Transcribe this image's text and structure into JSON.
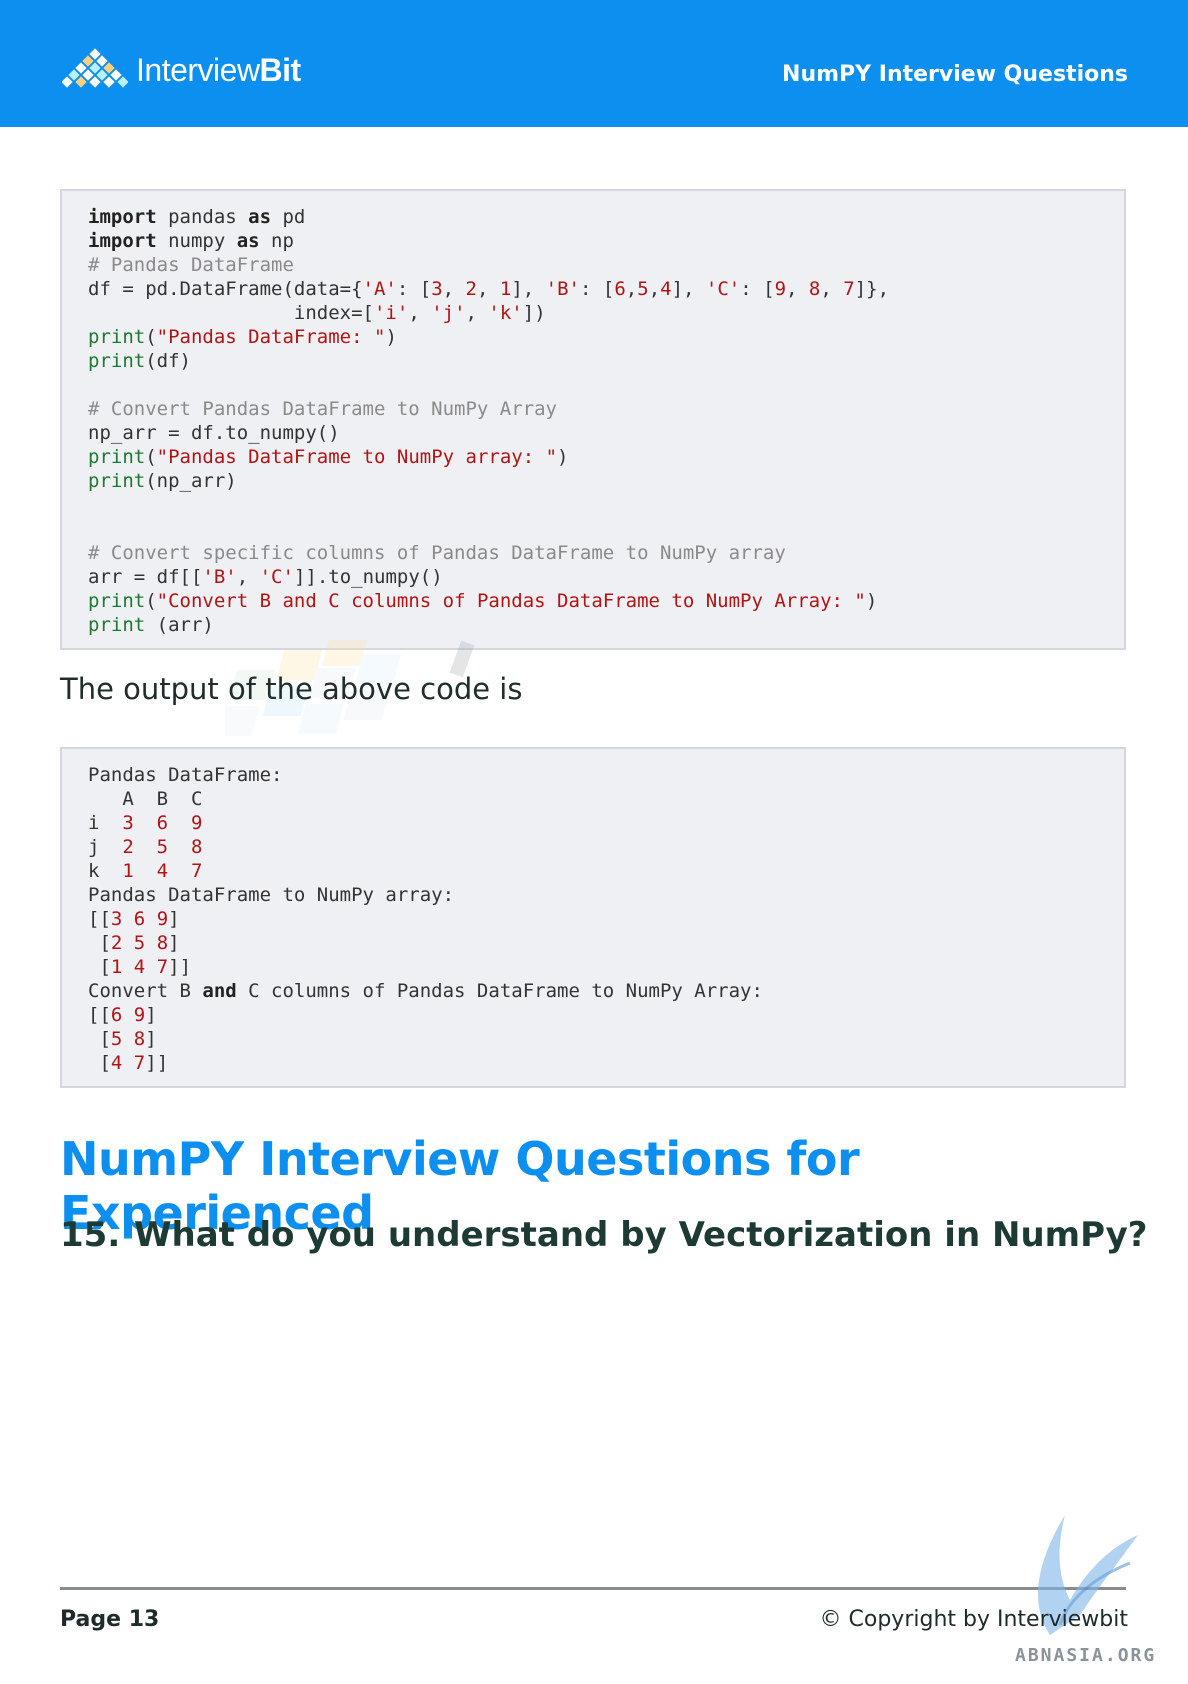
{
  "header": {
    "logo_text_light": "Interview",
    "logo_text_bold": "Bit",
    "title": "NumPY Interview Questions"
  },
  "code_input": {
    "lines": [
      [
        {
          "t": "import",
          "c": "kw"
        },
        {
          "t": " pandas ",
          "c": ""
        },
        {
          "t": "as",
          "c": "kw"
        },
        {
          "t": " pd",
          "c": ""
        }
      ],
      [
        {
          "t": "import",
          "c": "kw"
        },
        {
          "t": " numpy ",
          "c": ""
        },
        {
          "t": "as",
          "c": "kw"
        },
        {
          "t": " np",
          "c": ""
        }
      ],
      [
        {
          "t": "# Pandas DataFrame",
          "c": "cm"
        }
      ],
      [
        {
          "t": "df = pd.DataFrame(data={",
          "c": ""
        },
        {
          "t": "'A'",
          "c": "st"
        },
        {
          "t": ": [",
          "c": ""
        },
        {
          "t": "3",
          "c": "num"
        },
        {
          "t": ", ",
          "c": ""
        },
        {
          "t": "2",
          "c": "num"
        },
        {
          "t": ", ",
          "c": ""
        },
        {
          "t": "1",
          "c": "num"
        },
        {
          "t": "], ",
          "c": ""
        },
        {
          "t": "'B'",
          "c": "st"
        },
        {
          "t": ": [",
          "c": ""
        },
        {
          "t": "6",
          "c": "num"
        },
        {
          "t": ",",
          "c": ""
        },
        {
          "t": "5",
          "c": "num"
        },
        {
          "t": ",",
          "c": ""
        },
        {
          "t": "4",
          "c": "num"
        },
        {
          "t": "], ",
          "c": ""
        },
        {
          "t": "'C'",
          "c": "st"
        },
        {
          "t": ": [",
          "c": ""
        },
        {
          "t": "9",
          "c": "num"
        },
        {
          "t": ", ",
          "c": ""
        },
        {
          "t": "8",
          "c": "num"
        },
        {
          "t": ", ",
          "c": ""
        },
        {
          "t": "7",
          "c": "num"
        },
        {
          "t": "]},",
          "c": ""
        }
      ],
      [
        {
          "t": "                  index=[",
          "c": ""
        },
        {
          "t": "'i'",
          "c": "st"
        },
        {
          "t": ", ",
          "c": ""
        },
        {
          "t": "'j'",
          "c": "st"
        },
        {
          "t": ", ",
          "c": ""
        },
        {
          "t": "'k'",
          "c": "st"
        },
        {
          "t": "])",
          "c": ""
        }
      ],
      [
        {
          "t": "print",
          "c": "fn"
        },
        {
          "t": "(",
          "c": ""
        },
        {
          "t": "\"Pandas DataFrame: \"",
          "c": "st"
        },
        {
          "t": ")",
          "c": ""
        }
      ],
      [
        {
          "t": "print",
          "c": "fn"
        },
        {
          "t": "(df)",
          "c": ""
        }
      ],
      [
        {
          "t": "",
          "c": ""
        }
      ],
      [
        {
          "t": "# Convert Pandas DataFrame to NumPy Array",
          "c": "cm"
        }
      ],
      [
        {
          "t": "np_arr = df.to_numpy()",
          "c": ""
        }
      ],
      [
        {
          "t": "print",
          "c": "fn"
        },
        {
          "t": "(",
          "c": ""
        },
        {
          "t": "\"Pandas DataFrame to NumPy array: \"",
          "c": "st"
        },
        {
          "t": ")",
          "c": ""
        }
      ],
      [
        {
          "t": "print",
          "c": "fn"
        },
        {
          "t": "(np_arr)",
          "c": ""
        }
      ],
      [
        {
          "t": "",
          "c": ""
        }
      ],
      [
        {
          "t": "",
          "c": ""
        }
      ],
      [
        {
          "t": "# Convert specific columns of Pandas DataFrame to NumPy array",
          "c": "cm"
        }
      ],
      [
        {
          "t": "arr = df[[",
          "c": ""
        },
        {
          "t": "'B'",
          "c": "st"
        },
        {
          "t": ", ",
          "c": ""
        },
        {
          "t": "'C'",
          "c": "st"
        },
        {
          "t": "]].to_numpy()",
          "c": ""
        }
      ],
      [
        {
          "t": "print",
          "c": "fn"
        },
        {
          "t": "(",
          "c": ""
        },
        {
          "t": "\"Convert B and C columns of Pandas DataFrame to NumPy Array: \"",
          "c": "st"
        },
        {
          "t": ")",
          "c": ""
        }
      ],
      [
        {
          "t": "print",
          "c": "fn"
        },
        {
          "t": " (arr)",
          "c": ""
        }
      ]
    ]
  },
  "prose": {
    "output_intro": "The output of the above code is"
  },
  "code_output": {
    "lines": [
      [
        {
          "t": "Pandas DataFrame:",
          "c": ""
        }
      ],
      [
        {
          "t": "   A  B  C",
          "c": ""
        }
      ],
      [
        {
          "t": "i  ",
          "c": ""
        },
        {
          "t": "3",
          "c": "num"
        },
        {
          "t": "  ",
          "c": ""
        },
        {
          "t": "6",
          "c": "num"
        },
        {
          "t": "  ",
          "c": ""
        },
        {
          "t": "9",
          "c": "num"
        }
      ],
      [
        {
          "t": "j  ",
          "c": ""
        },
        {
          "t": "2",
          "c": "num"
        },
        {
          "t": "  ",
          "c": ""
        },
        {
          "t": "5",
          "c": "num"
        },
        {
          "t": "  ",
          "c": ""
        },
        {
          "t": "8",
          "c": "num"
        }
      ],
      [
        {
          "t": "k  ",
          "c": ""
        },
        {
          "t": "1",
          "c": "num"
        },
        {
          "t": "  ",
          "c": ""
        },
        {
          "t": "4",
          "c": "num"
        },
        {
          "t": "  ",
          "c": ""
        },
        {
          "t": "7",
          "c": "num"
        }
      ],
      [
        {
          "t": "Pandas DataFrame to NumPy array:",
          "c": ""
        }
      ],
      [
        {
          "t": "[[",
          "c": ""
        },
        {
          "t": "3",
          "c": "num"
        },
        {
          "t": " ",
          "c": ""
        },
        {
          "t": "6",
          "c": "num"
        },
        {
          "t": " ",
          "c": ""
        },
        {
          "t": "9",
          "c": "num"
        },
        {
          "t": "]",
          "c": ""
        }
      ],
      [
        {
          "t": " [",
          "c": ""
        },
        {
          "t": "2",
          "c": "num"
        },
        {
          "t": " ",
          "c": ""
        },
        {
          "t": "5",
          "c": "num"
        },
        {
          "t": " ",
          "c": ""
        },
        {
          "t": "8",
          "c": "num"
        },
        {
          "t": "]",
          "c": ""
        }
      ],
      [
        {
          "t": " [",
          "c": ""
        },
        {
          "t": "1",
          "c": "num"
        },
        {
          "t": " ",
          "c": ""
        },
        {
          "t": "4",
          "c": "num"
        },
        {
          "t": " ",
          "c": ""
        },
        {
          "t": "7",
          "c": "num"
        },
        {
          "t": "]]",
          "c": ""
        }
      ],
      [
        {
          "t": "Convert B ",
          "c": ""
        },
        {
          "t": "and",
          "c": "kw"
        },
        {
          "t": " C columns of Pandas DataFrame to NumPy Array:",
          "c": ""
        }
      ],
      [
        {
          "t": "[[",
          "c": ""
        },
        {
          "t": "6",
          "c": "num"
        },
        {
          "t": " ",
          "c": ""
        },
        {
          "t": "9",
          "c": "num"
        },
        {
          "t": "]",
          "c": ""
        }
      ],
      [
        {
          "t": " [",
          "c": ""
        },
        {
          "t": "5",
          "c": "num"
        },
        {
          "t": " ",
          "c": ""
        },
        {
          "t": "8",
          "c": "num"
        },
        {
          "t": "]",
          "c": ""
        }
      ],
      [
        {
          "t": " [",
          "c": ""
        },
        {
          "t": "4",
          "c": "num"
        },
        {
          "t": " ",
          "c": ""
        },
        {
          "t": "7",
          "c": "num"
        },
        {
          "t": "]]",
          "c": ""
        }
      ]
    ]
  },
  "section": {
    "heading": "NumPY Interview Questions for Experienced"
  },
  "question": {
    "number": "15.",
    "text": "What do you understand by Vectorization in NumPy?"
  },
  "footer": {
    "page_label": "Page 13",
    "copyright": "© Copyright by Interviewbit",
    "site_watermark": "ABNASIA.ORG"
  },
  "colors": {
    "brand_blue": "#0d8ff0",
    "heading_dark": "#1d3a35",
    "code_bg": "#eef0f4",
    "string_red": "#b21414",
    "func_green": "#1d7b2f",
    "comment_gray": "#8a8a8a"
  }
}
